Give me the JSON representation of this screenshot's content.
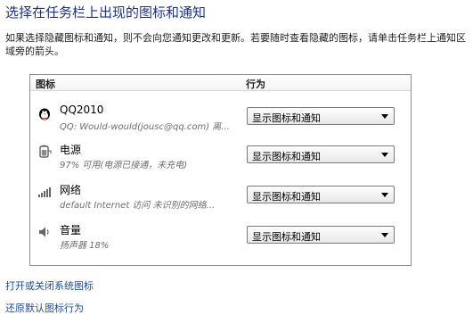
{
  "page": {
    "title": "选择在任务栏上出现的图标和通知",
    "description": "如果选择隐藏图标和通知，则不会向您通知更改和更新。若要随时查看隐藏的图标，请单击任务栏上通知区域旁的箭头。"
  },
  "table": {
    "column_icon": "图标",
    "column_behavior": "行为",
    "rows": [
      {
        "icon": "qq-penguin-icon",
        "name": "QQ2010",
        "subtitle": "QQ: Would-would(jousc@qq.com) 离...",
        "behavior": "显示图标和通知"
      },
      {
        "icon": "power-icon",
        "name": "电源",
        "subtitle": "97% 可用(电源已接通，未充电)",
        "behavior": "显示图标和通知"
      },
      {
        "icon": "network-icon",
        "name": "网络",
        "subtitle": "default Internet 访问 未识别的网络...",
        "behavior": "显示图标和通知"
      },
      {
        "icon": "volume-icon",
        "name": "音量",
        "subtitle": "扬声器 18%",
        "behavior": "显示图标和通知"
      }
    ]
  },
  "links": {
    "toggle_system_icons": "打开或关闭系统图标",
    "restore_default": "还原默认图标行为"
  },
  "colors": {
    "title": "#1e3287",
    "link": "#1e4a9c",
    "panel_border": "#8e8f8f"
  }
}
